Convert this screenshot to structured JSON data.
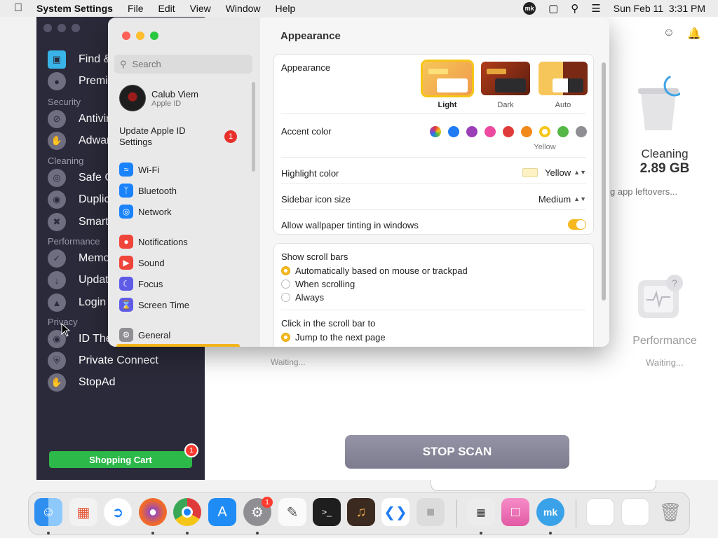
{
  "menubar": {
    "app_name": "System Settings",
    "menus": [
      "File",
      "Edit",
      "View",
      "Window",
      "Help"
    ],
    "datetime": "Sun Feb 11  3:31 PM",
    "tray_icons": [
      "mk-icon",
      "window-icon",
      "search-icon",
      "control-center-icon"
    ]
  },
  "background_app": {
    "sidebar": {
      "items": [
        {
          "label": "Find &",
          "section": null,
          "active": true
        },
        {
          "label": "Premiu",
          "section": null
        },
        {
          "label": "Antivir",
          "section": "Security"
        },
        {
          "label": "Adwar",
          "section": "Security"
        },
        {
          "label": "Safe C",
          "section": "Cleaning"
        },
        {
          "label": "Duplic",
          "section": "Cleaning"
        },
        {
          "label": "Smart",
          "section": "Cleaning"
        },
        {
          "label": "Memo",
          "section": "Performance"
        },
        {
          "label": "Updat",
          "section": "Performance"
        },
        {
          "label": "Login",
          "section": "Performance"
        },
        {
          "label": "ID The",
          "section": "Privacy"
        },
        {
          "label": "Private Connect",
          "section": "Privacy"
        },
        {
          "label": "StopAd",
          "section": "Privacy"
        }
      ],
      "sections": [
        "Security",
        "Cleaning",
        "Performance",
        "Privacy"
      ],
      "cart_label": "Shopping Cart",
      "cart_badge": "1"
    },
    "cleaning": {
      "title": "Cleaning",
      "size": "2.89 GB",
      "subtitle": "g app leftovers..."
    },
    "performance": {
      "title": "Performance",
      "subtitle": "Waiting..."
    },
    "left_waiting": "Waiting...",
    "stop_scan": "STOP SCAN"
  },
  "settings": {
    "search_placeholder": "Search",
    "profile": {
      "name": "Calub Viem",
      "subtitle": "Apple ID"
    },
    "update_notice": "Update Apple ID Settings",
    "update_badge": "1",
    "nav": [
      {
        "label": "Wi-Fi",
        "icon": "wifi-icon",
        "color": "#1a82fb"
      },
      {
        "label": "Bluetooth",
        "icon": "bluetooth-icon",
        "color": "#1a82fb"
      },
      {
        "label": "Network",
        "icon": "globe-icon",
        "color": "#1a82fb"
      },
      {
        "label": "Notifications",
        "icon": "bell-icon",
        "color": "#f0453a"
      },
      {
        "label": "Sound",
        "icon": "speaker-icon",
        "color": "#f0453a"
      },
      {
        "label": "Focus",
        "icon": "moon-icon",
        "color": "#5e5ce6"
      },
      {
        "label": "Screen Time",
        "icon": "hourglass-icon",
        "color": "#5e5ce6"
      },
      {
        "label": "General",
        "icon": "gear-icon",
        "color": "#8e8e93"
      }
    ],
    "page_title": "Appearance",
    "appearance": {
      "label": "Appearance",
      "options": [
        "Light",
        "Dark",
        "Auto"
      ],
      "selected": "Light"
    },
    "accent": {
      "label": "Accent color",
      "colors": [
        "multicolor",
        "#1f7cf3",
        "#9b3fb7",
        "#ec4aa0",
        "#e03b3b",
        "#f18a1b",
        "#f5c518",
        "#55b846",
        "#8e8e93"
      ],
      "selected_name": "Yellow"
    },
    "highlight": {
      "label": "Highlight color",
      "value": "Yellow"
    },
    "sidebar_icon_size": {
      "label": "Sidebar icon size",
      "value": "Medium"
    },
    "wallpaper_tinting": {
      "label": "Allow wallpaper tinting in windows",
      "on": true
    },
    "scroll_bars": {
      "label": "Show scroll bars",
      "options": [
        "Automatically based on mouse or trackpad",
        "When scrolling",
        "Always"
      ],
      "selected": "Automatically based on mouse or trackpad"
    },
    "click_scroll": {
      "label": "Click in the scroll bar to",
      "options": [
        "Jump to the next page"
      ],
      "selected": "Jump to the next page"
    }
  },
  "dock": {
    "apps": [
      "Finder",
      "Launchpad",
      "Safari",
      "Firefox",
      "Chrome",
      "App Store",
      "System Settings",
      "TextEdit",
      "Terminal",
      "GarageBand",
      "Visual Studio Code",
      "Roblox",
      "Puzzle",
      "CleanMyMac",
      "MacKeeper",
      "Downloads",
      "Documents",
      "Trash"
    ],
    "settings_badge": "1"
  }
}
